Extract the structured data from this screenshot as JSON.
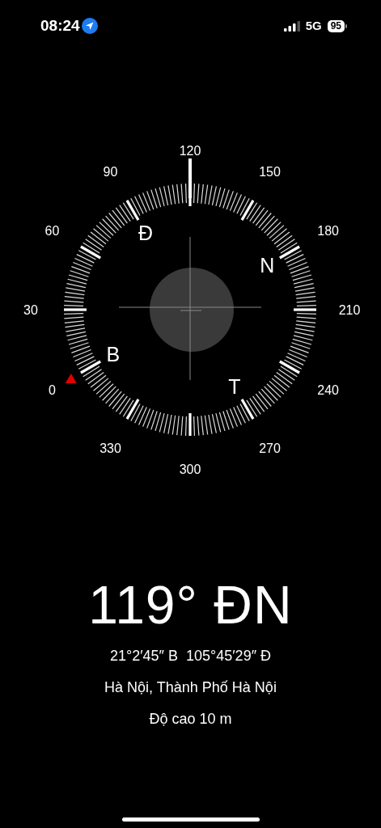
{
  "status_bar": {
    "time": "08:24",
    "network": "5G",
    "battery": "95"
  },
  "compass": {
    "dial_labels": [
      "120",
      "150",
      "180",
      "210",
      "240",
      "270",
      "300",
      "330",
      "0",
      "30",
      "60",
      "90"
    ],
    "cardinals": [
      "Đ",
      "N",
      "T",
      "B"
    ]
  },
  "heading": "119° ĐN",
  "coordinates": "21°2′45″ B  105°45′29″ Đ",
  "place": "Hà Nội, Thành Phố Hà Nội",
  "altitude": "Độ cao 10 m"
}
